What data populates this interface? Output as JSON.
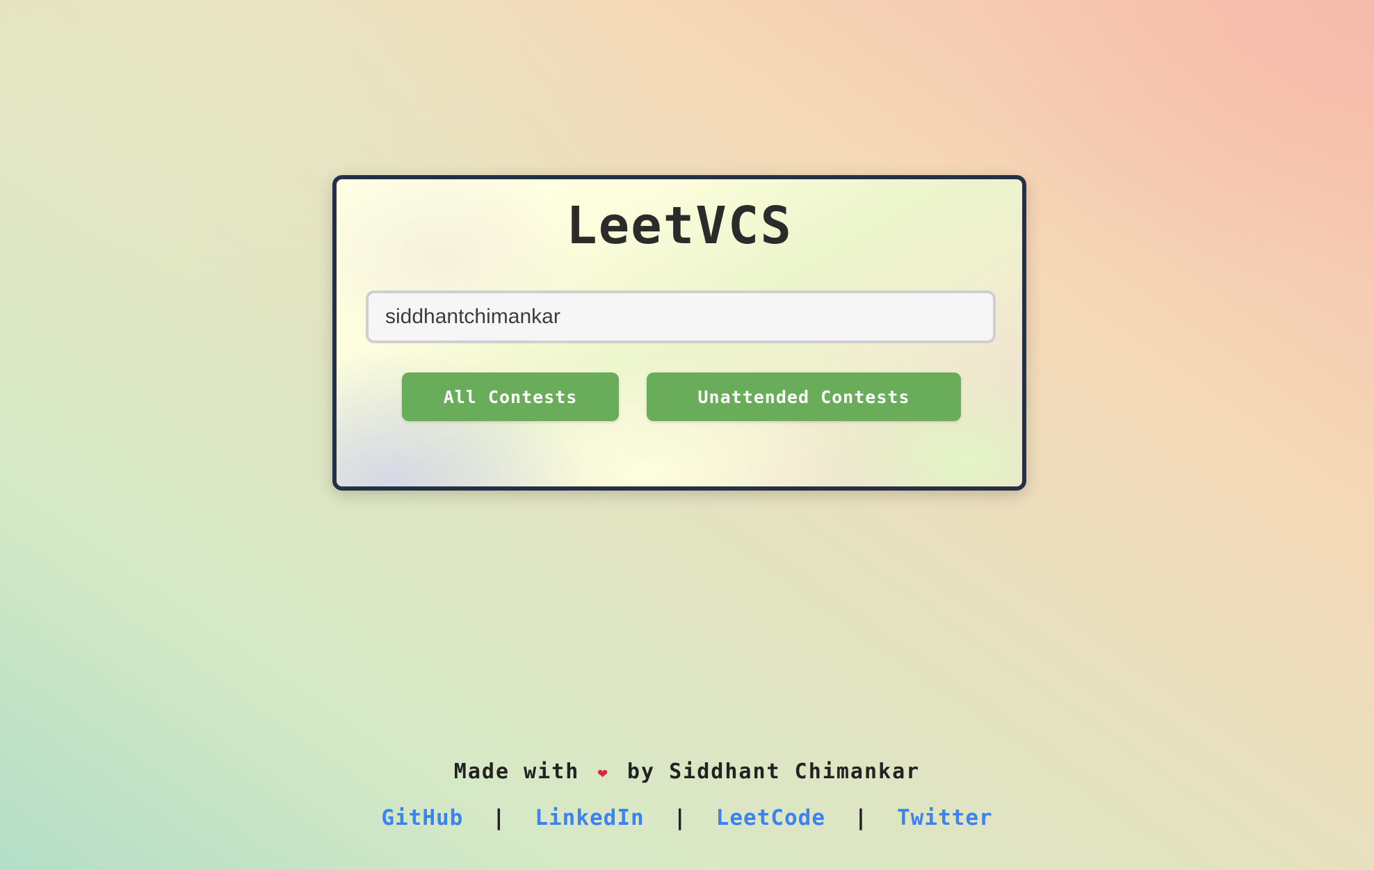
{
  "app": {
    "title": "LeetVCS"
  },
  "search": {
    "value": "siddhantchimankar"
  },
  "buttons": {
    "all_contests": "All Contests",
    "unattended_contests": "Unattended Contests"
  },
  "footer": {
    "made_with_prefix": "Made with",
    "heart": "❤",
    "made_with_suffix": "by Siddhant Chimankar",
    "separator": "|",
    "links": [
      {
        "label": "GitHub"
      },
      {
        "label": "LinkedIn"
      },
      {
        "label": "LeetCode"
      },
      {
        "label": "Twitter"
      }
    ]
  },
  "colors": {
    "button_green": "#69ad5a",
    "link_blue": "#3b82f6",
    "card_border": "#243048",
    "heart_red": "#e0253a"
  },
  "icons": {
    "heart": "heart-icon"
  }
}
